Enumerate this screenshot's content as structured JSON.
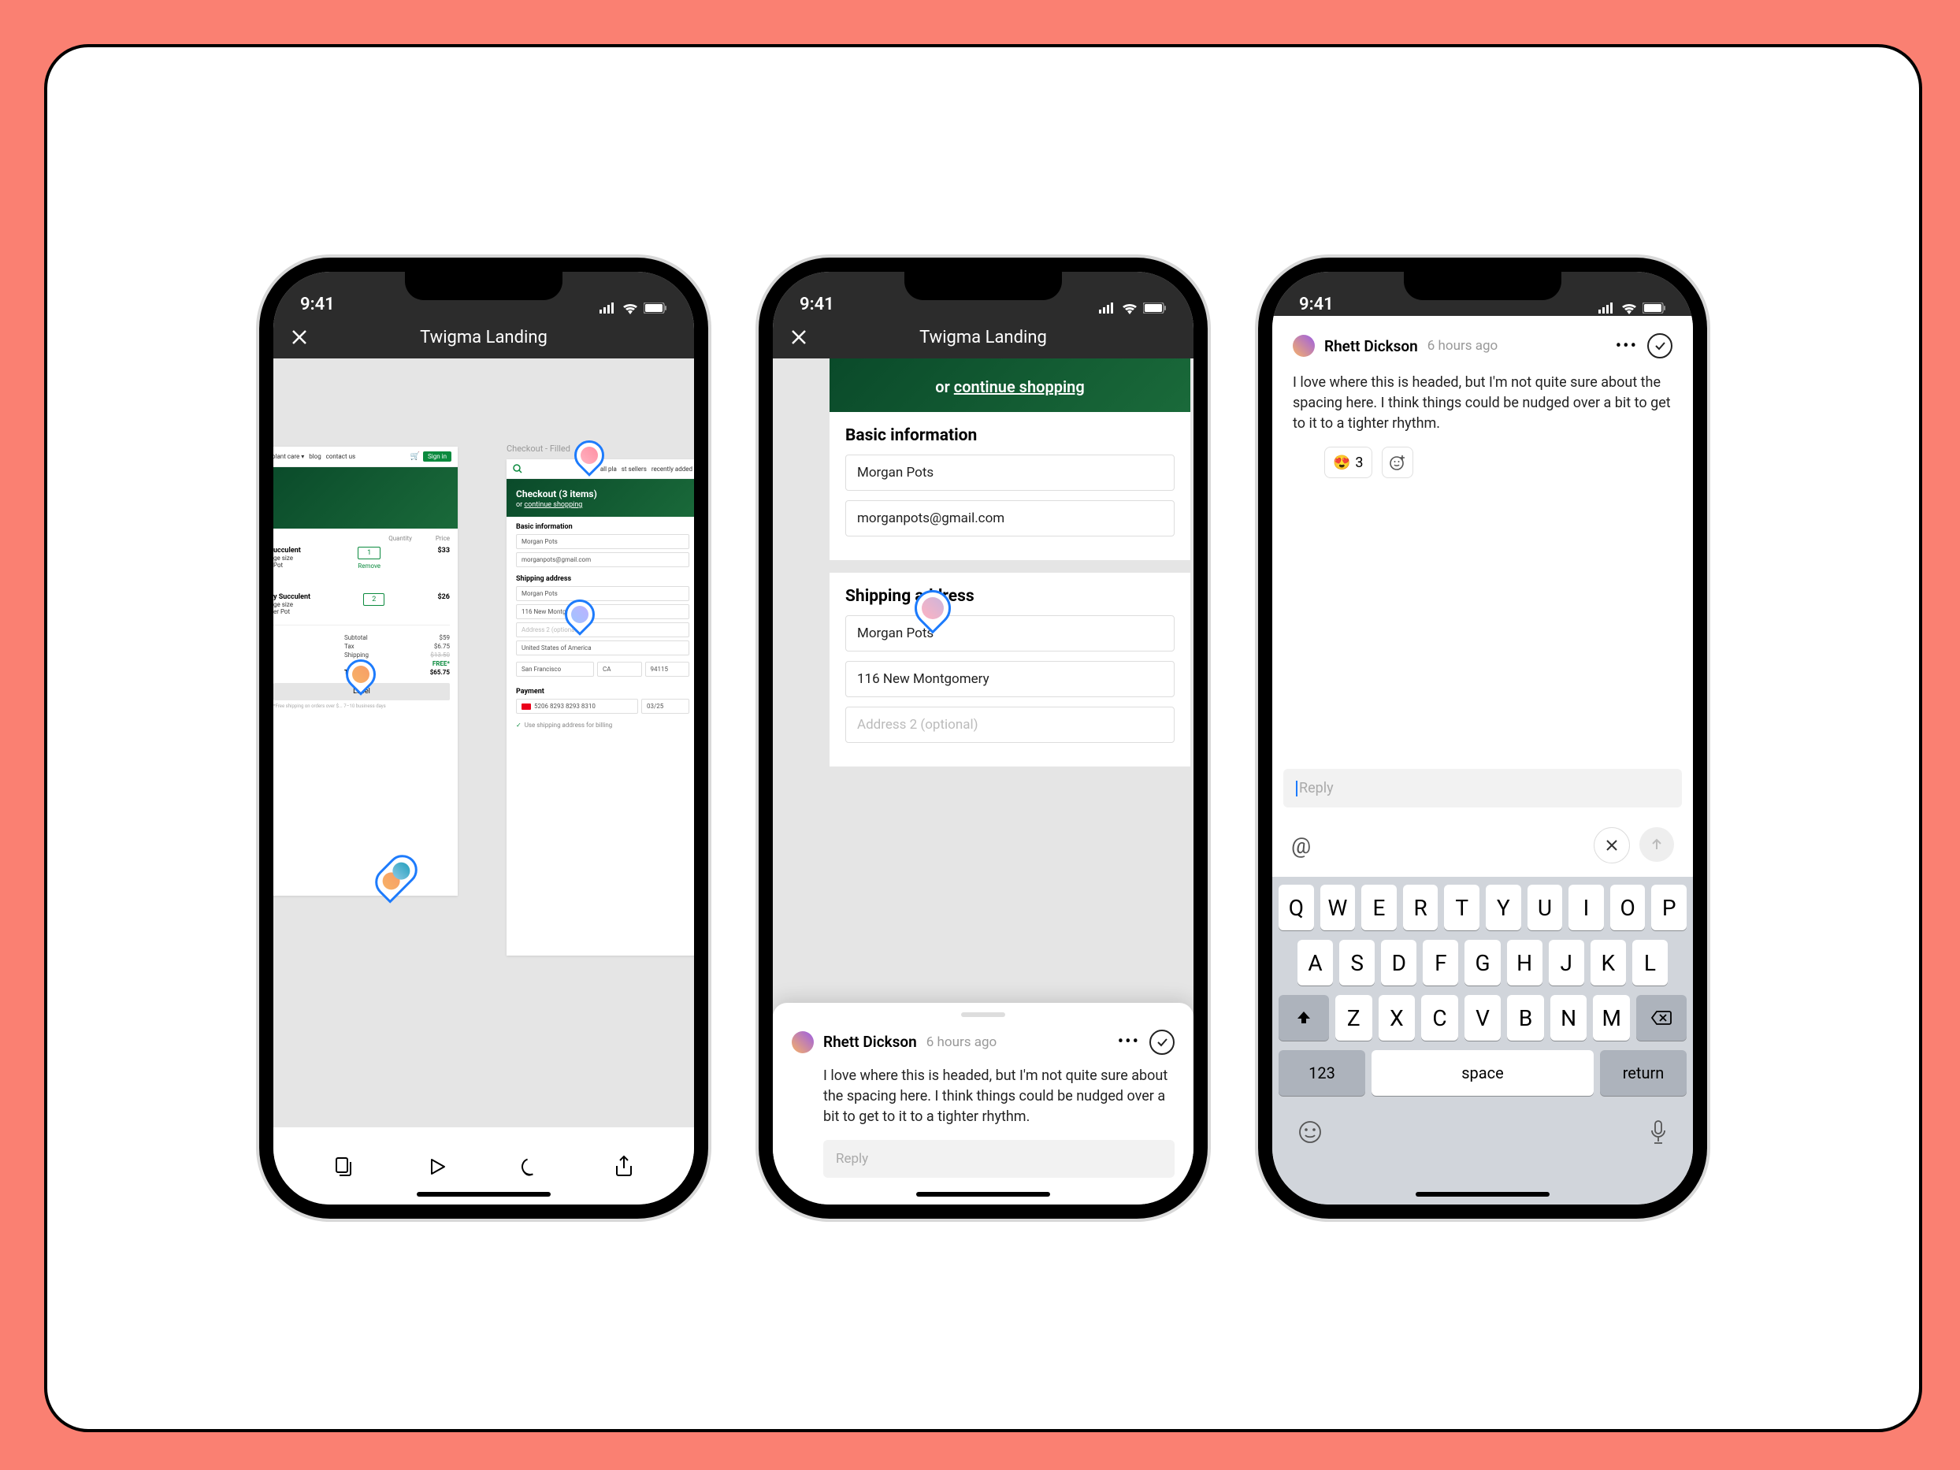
{
  "status_time": "9:41",
  "nav_title": "Twigma Landing",
  "frames": {
    "left": {
      "nav_items": [
        "plant care ▾",
        "blog",
        "contact us"
      ],
      "signin": "Sign in",
      "cols": [
        "Quantity",
        "Price"
      ],
      "items": [
        {
          "name": "ucculent",
          "sub1": "ge size",
          "sub2": "Pot",
          "qty": "1",
          "price": "$33",
          "action": "Remove"
        },
        {
          "name": "y Succulent",
          "sub1": "ge size",
          "sub2": "er Pot",
          "qty": "2",
          "price": "$26"
        }
      ],
      "subtotal_l": "Subtotal",
      "subtotal": "$59",
      "tax_l": "Tax",
      "tax": "$6.75",
      "ship_l": "Shipping",
      "ship_old": "$13.50",
      "ship": "FREE*",
      "total_l": "Total",
      "total": "$65.75",
      "cta": "Label",
      "footnote": "*Free shipping on orders over $... 7–10 business days"
    },
    "right": {
      "label": "Checkout - Filled",
      "nav_items": [
        "all pla",
        "st sellers",
        "recently added"
      ],
      "hero_title": "Checkout (3 items)",
      "hero_or": "or ",
      "hero_link": "continue shopping",
      "sec1": "Basic information",
      "name_field": "Morgan Pots",
      "email_field": "morganpots@gmail.com",
      "sec2": "Shipping address",
      "ship_name": "Morgan Pots",
      "addr1": "116 New Montgomery",
      "addr2": "Address 2 (optional)",
      "country": "United States of America",
      "city": "San Francisco",
      "state": "CA",
      "zip": "94115",
      "sec3": "Payment",
      "card": "5206 8293 8293 8310",
      "exp": "03/25",
      "billing": "Use shipping address for billing"
    }
  },
  "zoom": {
    "hero_or": "or ",
    "hero_link": "continue shopping",
    "sec1": "Basic information",
    "name": "Morgan Pots",
    "email": "morganpots@gmail.com",
    "sec2": "Shipping address",
    "ship_name": "Morgan Pots",
    "addr1": "116 New Montgomery",
    "addr2": "Address 2 (optional)"
  },
  "comment": {
    "author": "Rhett Dickson",
    "time": "6 hours ago",
    "body": "I love where this is headed, but I'm not quite sure about the spacing here. I think things could be nudged over a bit to get to it to a tighter rhythm.",
    "reply_placeholder": "Reply",
    "reaction_emoji": "😍",
    "reaction_count": "3"
  },
  "kbd": {
    "r1": [
      "Q",
      "W",
      "E",
      "R",
      "T",
      "Y",
      "U",
      "I",
      "O",
      "P"
    ],
    "r2": [
      "A",
      "S",
      "D",
      "F",
      "G",
      "H",
      "J",
      "K",
      "L"
    ],
    "r3": [
      "Z",
      "X",
      "C",
      "V",
      "B",
      "N",
      "M"
    ],
    "num": "123",
    "space": "space",
    "return": "return"
  },
  "at_symbol": "@"
}
